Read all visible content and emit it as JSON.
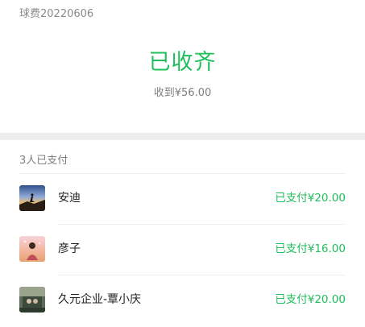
{
  "summary": {
    "title": "球费20220606",
    "status": "已收齐",
    "received": "收到¥56.00"
  },
  "payments": {
    "header": "3人已支付",
    "items": [
      {
        "name": "安迪",
        "paid": "已支付¥20.00"
      },
      {
        "name": "彦子",
        "paid": "已支付¥16.00"
      },
      {
        "name": "久元企业-覃小庆",
        "paid": "已支付¥20.00"
      }
    ]
  },
  "colors": {
    "accent": "#1fbf5c",
    "background": "#ededed"
  }
}
